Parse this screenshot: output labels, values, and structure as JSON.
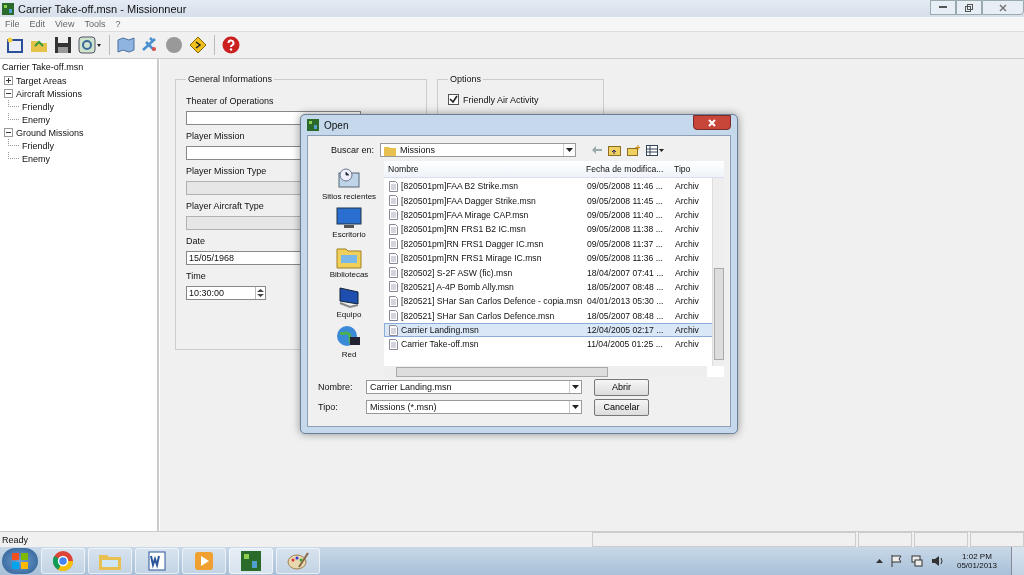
{
  "window": {
    "title": "Carrier Take-off.msn - Missionneur"
  },
  "menu": [
    "File",
    "Edit",
    "View",
    "Tools",
    "?"
  ],
  "tree": {
    "label": "Carrier Take-off.msn",
    "children": [
      {
        "label": "Target Areas",
        "expanded": false
      },
      {
        "label": "Aircraft Missions",
        "expanded": true,
        "children": [
          {
            "label": "Friendly"
          },
          {
            "label": "Enemy"
          }
        ]
      },
      {
        "label": "Ground Missions",
        "expanded": true,
        "children": [
          {
            "label": "Friendly"
          },
          {
            "label": "Enemy"
          }
        ]
      }
    ]
  },
  "general": {
    "title": "General Informations",
    "fields": [
      {
        "label": "Theater of Operations",
        "disabled": false,
        "kind": "text"
      },
      {
        "label": "Player Mission",
        "disabled": false,
        "kind": "text"
      },
      {
        "label": "Player Mission Type",
        "disabled": true,
        "kind": "text"
      },
      {
        "label": "Player Aircraft Type",
        "disabled": true,
        "kind": "text"
      },
      {
        "label": "Date",
        "value": "15/05/1968",
        "disabled": false,
        "kind": "text"
      },
      {
        "label": "Time",
        "value": "10:30:00",
        "kind": "spin"
      }
    ]
  },
  "options": {
    "title": "Options",
    "items": [
      {
        "label": "Friendly Air Activity",
        "checked": true
      }
    ]
  },
  "dialog": {
    "title": "Open",
    "look_in_label": "Buscar en:",
    "look_in": "Missions",
    "places": [
      "Sitios recientes",
      "Escritorio",
      "Bibliotecas",
      "Equipo",
      "Red"
    ],
    "columns": [
      "Nombre",
      "Fecha de modifica...",
      "Tipo"
    ],
    "files": [
      {
        "name": "[820501pm]FAA B2 Strike.msn",
        "date": "09/05/2008 11:46 ...",
        "type": "Archiv",
        "selected": false
      },
      {
        "name": "[820501pm]FAA Dagger Strike.msn",
        "date": "09/05/2008 11:45 ...",
        "type": "Archiv",
        "selected": false
      },
      {
        "name": "[820501pm]FAA Mirage CAP.msn",
        "date": "09/05/2008 11:40 ...",
        "type": "Archiv",
        "selected": false
      },
      {
        "name": "[820501pm]RN FRS1 B2 IC.msn",
        "date": "09/05/2008 11:38 ...",
        "type": "Archiv",
        "selected": false
      },
      {
        "name": "[820501pm]RN FRS1 Dagger  IC.msn",
        "date": "09/05/2008 11:37 ...",
        "type": "Archiv",
        "selected": false
      },
      {
        "name": "[820501pm]RN FRS1 Mirage  IC.msn",
        "date": "09/05/2008 11:36 ...",
        "type": "Archiv",
        "selected": false
      },
      {
        "name": "[820502] S-2F ASW (fic).msn",
        "date": "18/04/2007 07:41 ...",
        "type": "Archiv",
        "selected": false
      },
      {
        "name": "[820521] A-4P Bomb Ally.msn",
        "date": "18/05/2007 08:48 ...",
        "type": "Archiv",
        "selected": false
      },
      {
        "name": "[820521] SHar San Carlos Defence - copia.msn",
        "date": "04/01/2013 05:30 ...",
        "type": "Archiv",
        "selected": false
      },
      {
        "name": "[820521] SHar San Carlos Defence.msn",
        "date": "18/05/2007 08:48 ...",
        "type": "Archiv",
        "selected": false
      },
      {
        "name": "Carrier Landing.msn",
        "date": "12/04/2005 02:17 ...",
        "type": "Archiv",
        "selected": true
      },
      {
        "name": "Carrier Take-off.msn",
        "date": "11/04/2005 01:25 ...",
        "type": "Archiv",
        "selected": false
      }
    ],
    "name_label": "Nombre:",
    "name_value": "Carrier Landing.msn",
    "type_label": "Tipo:",
    "type_value": "Missions (*.msn)",
    "open_button": "Abrir",
    "cancel_button": "Cancelar"
  },
  "status_bar": {
    "text": "Ready"
  },
  "taskbar": {
    "time": "1:02 PM",
    "date": "05/01/2013"
  }
}
